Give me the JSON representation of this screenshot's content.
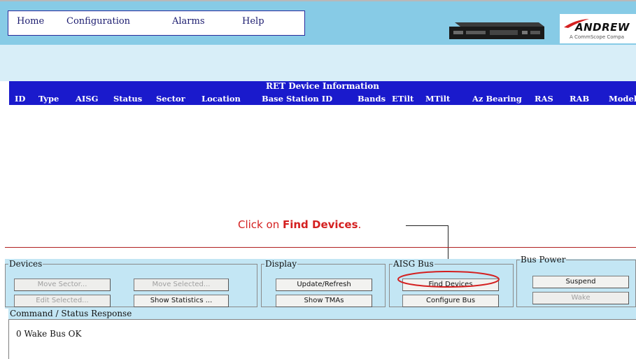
{
  "nav": {
    "items": [
      {
        "label": "Home"
      },
      {
        "label": "Configuration"
      },
      {
        "label": "Alarms"
      },
      {
        "label": "Help"
      }
    ]
  },
  "logo": {
    "name": "ANDREW",
    "tagline": "A CommScope Compa"
  },
  "ret_table": {
    "title": "RET Device Information",
    "columns": [
      "ID",
      "Type",
      "AISG",
      "Status",
      "Sector",
      "Location",
      "Base Station ID",
      "Bands",
      "ETilt",
      "MTilt",
      "Az Bearing",
      "RAS",
      "RAB",
      "Model"
    ],
    "rows": []
  },
  "annotation": {
    "prefix": "Click on ",
    "bold": "Find Devices",
    "suffix": "."
  },
  "groups": {
    "devices": {
      "legend": "Devices",
      "move_sector": "Move Sector...",
      "move_selected": "Move Selected...",
      "edit_selected": "Edit Selected...",
      "show_statistics": "Show Statistics ..."
    },
    "display": {
      "legend": "Display",
      "update_refresh": "Update/Refresh",
      "show_tmas": "Show TMAs"
    },
    "aisg_bus": {
      "legend": "AISG Bus",
      "find_devices": "Find Devices",
      "configure_bus": "Configure Bus"
    },
    "bus_power": {
      "legend": "Bus Power",
      "suspend": "Suspend",
      "wake": "Wake"
    }
  },
  "command_status": {
    "label": "Command / Status Response",
    "text": "0 Wake Bus OK"
  },
  "colors": {
    "header_bg": "#87cbe6",
    "table_header_bg": "#1a1acc",
    "annotation": "#d42020",
    "panel_bg": "#c3e6f4"
  }
}
